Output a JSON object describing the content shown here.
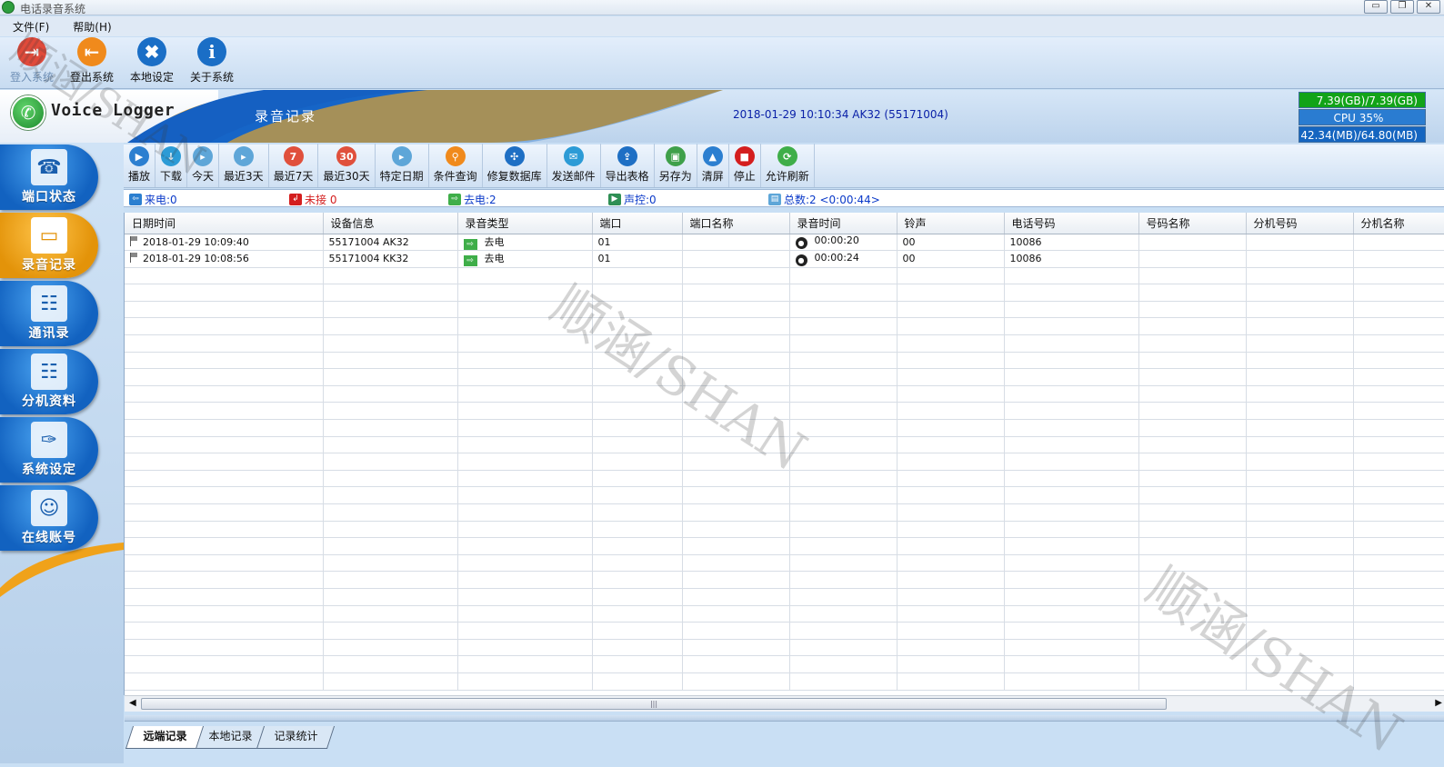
{
  "window": {
    "title": "电话录音系统"
  },
  "menu": [
    "文件(F)",
    "帮助(H)"
  ],
  "top_toolbar": [
    {
      "label": "登入系统",
      "icon": "login-icon",
      "color": "#e04a3a",
      "disabled": true
    },
    {
      "label": "登出系统",
      "icon": "logout-icon",
      "color": "#f08a1c",
      "disabled": false
    },
    {
      "label": "本地设定",
      "icon": "tools-icon",
      "color": "#1a6ec6",
      "disabled": false
    },
    {
      "label": "关于系统",
      "icon": "info-icon",
      "color": "#1a6ec6",
      "disabled": false
    }
  ],
  "banner": {
    "logo_text": "Voice Logger",
    "section": "录音记录",
    "info": "2018-01-29 10:10:34 AK32 (55171004)",
    "stats": {
      "disk": "7.39(GB)/7.39(GB)",
      "cpu": "CPU 35%",
      "memory": "42.34(MB)/64.80(MB)"
    }
  },
  "sidebar": [
    {
      "label": "端口状态",
      "icon": "port-status-icon",
      "active": false
    },
    {
      "label": "录音记录",
      "icon": "recording-icon",
      "active": true
    },
    {
      "label": "通讯录",
      "icon": "contacts-icon",
      "active": false
    },
    {
      "label": "分机资料",
      "icon": "extension-info-icon",
      "active": false
    },
    {
      "label": "系统设定",
      "icon": "wrench-icon",
      "active": false
    },
    {
      "label": "在线账号",
      "icon": "online-users-icon",
      "active": false
    }
  ],
  "record_toolbar": [
    {
      "label": "播放",
      "icon": "play-icon",
      "color": "#2c7fd0"
    },
    {
      "label": "下载",
      "icon": "download-icon",
      "color": "#2c9bd6"
    },
    {
      "label": "今天",
      "icon": "today-icon",
      "color": "#5ea6d8"
    },
    {
      "label": "最近3天",
      "icon": "last3days-icon",
      "color": "#5ea6d8"
    },
    {
      "label": "最近7天",
      "icon": "last7days-icon",
      "color": "#e0503c"
    },
    {
      "label": "最近30天",
      "icon": "last30days-icon",
      "color": "#e0503c"
    },
    {
      "label": "特定日期",
      "icon": "date-icon",
      "color": "#5ea6d8"
    },
    {
      "label": "条件查询",
      "icon": "search-icon",
      "color": "#f08a1c"
    },
    {
      "label": "修复数据库",
      "icon": "repair-database-icon",
      "color": "#1e6fc4"
    },
    {
      "label": "发送邮件",
      "icon": "mail-icon",
      "color": "#2c9bd6"
    },
    {
      "label": "导出表格",
      "icon": "export-icon",
      "color": "#1e6fc4"
    },
    {
      "label": "另存为",
      "icon": "save-as-icon",
      "color": "#3fa04a"
    },
    {
      "label": "清屏",
      "icon": "clear-screen-icon",
      "color": "#2c7fd0"
    },
    {
      "label": "停止",
      "icon": "stop-icon",
      "color": "#d41e1e"
    },
    {
      "label": "允许刷新",
      "icon": "refresh-icon",
      "color": "#3fae49"
    }
  ],
  "status": {
    "incoming": "来电:0",
    "missed": "未接 0",
    "outgoing": "去电:2",
    "voice_control": "声控:0",
    "total": "总数:2 <0:00:44>"
  },
  "table": {
    "columns": [
      "日期时间",
      "设备信息",
      "录音类型",
      "端口",
      "端口名称",
      "录音时间",
      "铃声",
      "电话号码",
      "号码名称",
      "分机号码",
      "分机名称"
    ],
    "rows": [
      [
        "2018-01-29 10:09:40",
        "55171004 AK32",
        "去电",
        "01",
        "",
        "00:00:20",
        "00",
        "10086",
        "",
        "",
        ""
      ],
      [
        "2018-01-29 10:08:56",
        "55171004 KK32",
        "去电",
        "01",
        "",
        "00:00:24",
        "00",
        "10086",
        "",
        "",
        ""
      ]
    ]
  },
  "bottom_tabs": [
    {
      "label": "远端记录",
      "active": true
    },
    {
      "label": "本地记录",
      "active": false
    },
    {
      "label": "记录统计",
      "active": false
    }
  ],
  "watermark": "顺涵/SHAN"
}
